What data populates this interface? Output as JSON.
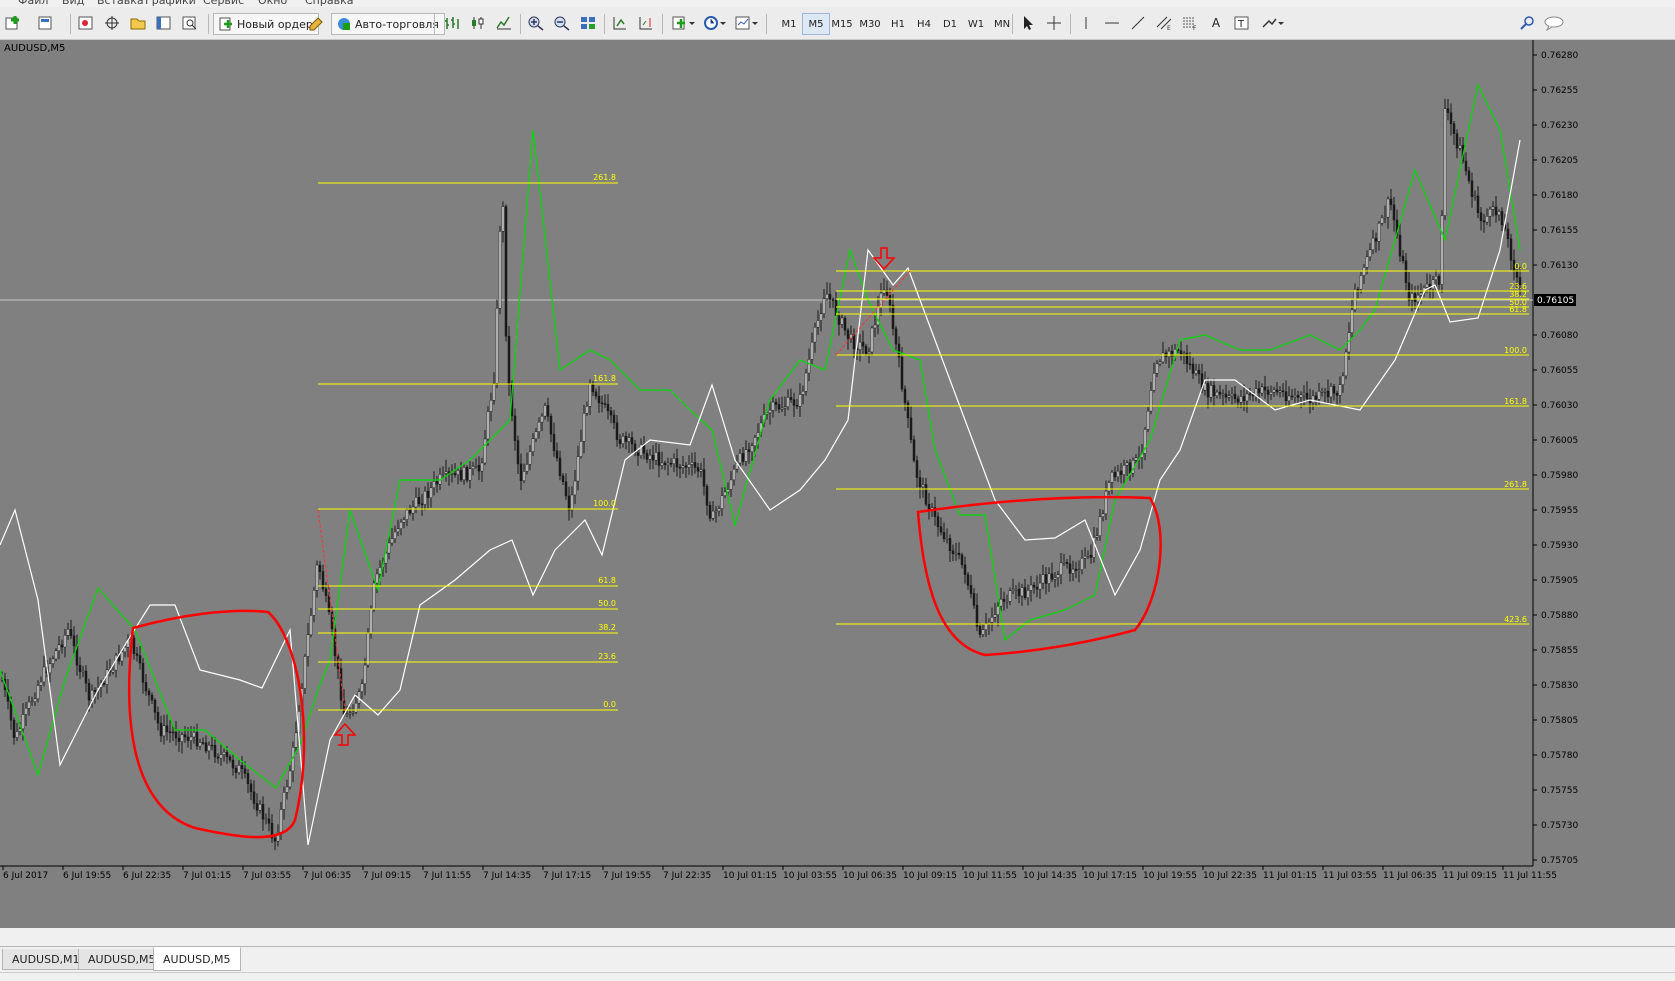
{
  "menu": [
    "Файл",
    "Вид",
    "Вставка",
    "Графики",
    "Сервис",
    "Окно",
    "Справка"
  ],
  "toolbar": {
    "new_order_label": "Новый ордер",
    "autotrade_label": "Авто-торговля",
    "timeframes": [
      "M1",
      "M5",
      "M15",
      "M30",
      "H1",
      "H4",
      "D1",
      "W1",
      "MN"
    ],
    "selected_timeframe": "M5"
  },
  "chart": {
    "title": "AUDUSD,M5",
    "current_price": "0.76105",
    "price_labels": [
      "0.76280",
      "0.76255",
      "0.76230",
      "0.76205",
      "0.76180",
      "0.76155",
      "0.76130",
      "0.76080",
      "0.76055",
      "0.76030",
      "0.76005",
      "0.75980",
      "0.75955",
      "0.75930",
      "0.75905",
      "0.75880",
      "0.75855",
      "0.75830",
      "0.75805",
      "0.75780",
      "0.75755",
      "0.75730",
      "0.75705"
    ],
    "time_labels": [
      "6 Jul 2017",
      "6 Jul 19:55",
      "6 Jul 22:35",
      "7 Jul 01:15",
      "7 Jul 03:55",
      "7 Jul 06:35",
      "7 Jul 09:15",
      "7 Jul 11:55",
      "7 Jul 14:35",
      "7 Jul 17:15",
      "7 Jul 19:55",
      "7 Jul 22:35",
      "10 Jul 01:15",
      "10 Jul 03:55",
      "10 Jul 06:35",
      "10 Jul 09:15",
      "10 Jul 11:55",
      "10 Jul 14:35",
      "10 Jul 17:15",
      "10 Jul 19:55",
      "10 Jul 22:35",
      "11 Jul 01:15",
      "11 Jul 03:55",
      "11 Jul 06:35",
      "11 Jul 09:15",
      "11 Jul 11:55"
    ],
    "fib_left_levels": [
      "261.8",
      "161.8",
      "100.0",
      "61.8",
      "50.0",
      "38.2",
      "23.6",
      "0.0"
    ],
    "fib_right_levels": [
      "0.0",
      "23.6",
      "38.2",
      "50.0",
      "61.8",
      "100.0",
      "161.8",
      "261.8",
      "423.6"
    ],
    "colors": {
      "background": "#808080",
      "candles": "#1a1a1a",
      "fib": "#ffff00",
      "ma_green": "#00dd00",
      "ma_white": "#ffffff",
      "annotation": "#ff0000"
    }
  },
  "tabs": [
    "AUDUSD,M1",
    "AUDUSD,M5",
    "AUDUSD,M5"
  ],
  "active_tab_index": 2
}
